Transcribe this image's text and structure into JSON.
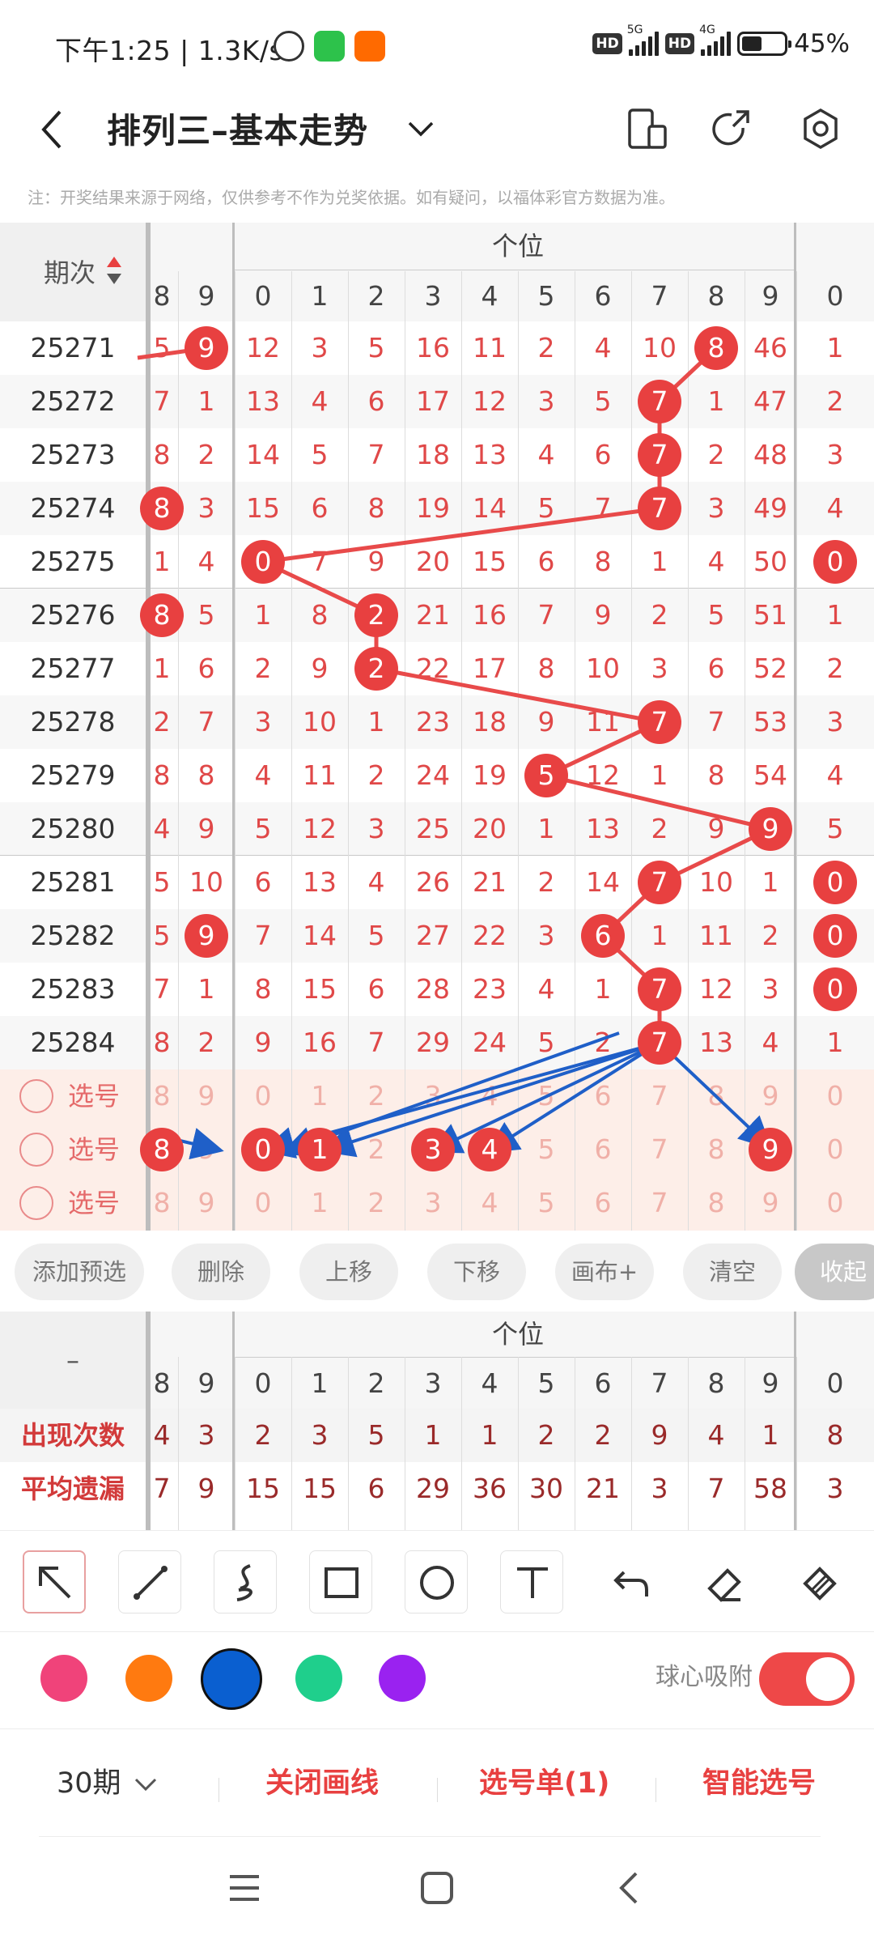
{
  "status_bar": {
    "time": "下午1:25",
    "speed": "1.3K/s",
    "battery": "45%",
    "net1": "5G",
    "net2": "4G",
    "hd": "HD"
  },
  "header": {
    "title": "排列三–基本走势"
  },
  "notice": "注：开奖结果来源于网络，仅供参考不作为兑奖依据。如有疑问，以福体彩官方数据为准。",
  "grid": {
    "period_header": "期次",
    "group_header": "个位",
    "columns": [
      "8",
      "9",
      "0",
      "1",
      "2",
      "3",
      "4",
      "5",
      "6",
      "7",
      "8",
      "9",
      "0"
    ],
    "rows": [
      {
        "p": "25271",
        "c": [
          "5",
          "9",
          "12",
          "3",
          "5",
          "16",
          "11",
          "2",
          "4",
          "10",
          "8",
          "46",
          "1"
        ]
      },
      {
        "p": "25272",
        "c": [
          "7",
          "1",
          "13",
          "4",
          "6",
          "17",
          "12",
          "3",
          "5",
          "7",
          "1",
          "47",
          "2"
        ]
      },
      {
        "p": "25273",
        "c": [
          "8",
          "2",
          "14",
          "5",
          "7",
          "18",
          "13",
          "4",
          "6",
          "7",
          "2",
          "48",
          "3"
        ]
      },
      {
        "p": "25274",
        "c": [
          "8",
          "3",
          "15",
          "6",
          "8",
          "19",
          "14",
          "5",
          "7",
          "7",
          "3",
          "49",
          "4"
        ]
      },
      {
        "p": "25275",
        "c": [
          "1",
          "4",
          "0",
          "7",
          "9",
          "20",
          "15",
          "6",
          "8",
          "1",
          "4",
          "50",
          "0"
        ]
      },
      {
        "p": "25276",
        "c": [
          "8",
          "5",
          "1",
          "8",
          "2",
          "21",
          "16",
          "7",
          "9",
          "2",
          "5",
          "51",
          "1"
        ]
      },
      {
        "p": "25277",
        "c": [
          "1",
          "6",
          "2",
          "9",
          "2",
          "22",
          "17",
          "8",
          "10",
          "3",
          "6",
          "52",
          "2"
        ]
      },
      {
        "p": "25278",
        "c": [
          "2",
          "7",
          "3",
          "10",
          "1",
          "23",
          "18",
          "9",
          "11",
          "7",
          "7",
          "53",
          "3"
        ]
      },
      {
        "p": "25279",
        "c": [
          "8",
          "8",
          "4",
          "11",
          "2",
          "24",
          "19",
          "5",
          "12",
          "1",
          "8",
          "54",
          "4"
        ]
      },
      {
        "p": "25280",
        "c": [
          "4",
          "9",
          "5",
          "12",
          "3",
          "25",
          "20",
          "1",
          "13",
          "2",
          "9",
          "9",
          "5"
        ]
      },
      {
        "p": "25281",
        "c": [
          "5",
          "10",
          "6",
          "13",
          "4",
          "26",
          "21",
          "2",
          "14",
          "7",
          "10",
          "1",
          "0"
        ]
      },
      {
        "p": "25282",
        "c": [
          "5",
          "9",
          "7",
          "14",
          "5",
          "27",
          "22",
          "3",
          "6",
          "1",
          "11",
          "2",
          "0"
        ]
      },
      {
        "p": "25283",
        "c": [
          "7",
          "1",
          "8",
          "15",
          "6",
          "28",
          "23",
          "4",
          "1",
          "7",
          "12",
          "3",
          "0"
        ]
      },
      {
        "p": "25284",
        "c": [
          "8",
          "2",
          "9",
          "16",
          "7",
          "29",
          "24",
          "5",
          "2",
          "7",
          "13",
          "4",
          "1"
        ]
      }
    ],
    "balls": [
      {
        "r": 0,
        "c": 1
      },
      {
        "r": 0,
        "c": 10
      },
      {
        "r": 1,
        "c": 9
      },
      {
        "r": 2,
        "c": 9
      },
      {
        "r": 3,
        "c": 0
      },
      {
        "r": 3,
        "c": 9
      },
      {
        "r": 4,
        "c": 2
      },
      {
        "r": 4,
        "c": 12
      },
      {
        "r": 5,
        "c": 0
      },
      {
        "r": 5,
        "c": 4
      },
      {
        "r": 6,
        "c": 4
      },
      {
        "r": 7,
        "c": 9
      },
      {
        "r": 8,
        "c": 7
      },
      {
        "r": 9,
        "c": 11
      },
      {
        "r": 10,
        "c": 9
      },
      {
        "r": 10,
        "c": 12
      },
      {
        "r": 11,
        "c": 1
      },
      {
        "r": 11,
        "c": 8
      },
      {
        "r": 11,
        "c": 12
      },
      {
        "r": 12,
        "c": 9
      },
      {
        "r": 12,
        "c": 12
      },
      {
        "r": 13,
        "c": 9
      }
    ],
    "option_label": "选号",
    "option_rows": [
      [
        "8",
        "9",
        "0",
        "1",
        "2",
        "3",
        "4",
        "5",
        "6",
        "7",
        "8",
        "9",
        "0"
      ],
      [
        "8",
        "9",
        "0",
        "1",
        "2",
        "3",
        "4",
        "5",
        "6",
        "7",
        "8",
        "9",
        "0"
      ],
      [
        "8",
        "9",
        "0",
        "1",
        "2",
        "3",
        "4",
        "5",
        "6",
        "7",
        "8",
        "9",
        "0"
      ]
    ],
    "selected_option_balls": [
      0,
      2,
      3,
      5,
      6,
      11
    ]
  },
  "actions": [
    "添加预选",
    "删除",
    "上移",
    "下移",
    "画布+",
    "清空",
    "收起"
  ],
  "stats": {
    "dash": "–",
    "group_header": "个位",
    "columns": [
      "8",
      "9",
      "0",
      "1",
      "2",
      "3",
      "4",
      "5",
      "6",
      "7",
      "8",
      "9",
      "0"
    ],
    "rows": [
      {
        "label": "出现次数",
        "c": [
          "4",
          "3",
          "2",
          "3",
          "5",
          "1",
          "1",
          "2",
          "2",
          "9",
          "4",
          "1",
          "8"
        ]
      },
      {
        "label": "平均遗漏",
        "c": [
          "7",
          "9",
          "15",
          "15",
          "6",
          "29",
          "36",
          "30",
          "21",
          "3",
          "7",
          "58",
          "3"
        ]
      }
    ]
  },
  "tools": [
    "select-arrow",
    "line",
    "curve",
    "rectangle",
    "circle",
    "text",
    "undo",
    "eraser",
    "clear-brush"
  ],
  "colors": [
    "#f0437a",
    "#ff7a10",
    "#0a5fd0",
    "#1fcf8c",
    "#9a22f0"
  ],
  "snap_label": "球心吸附",
  "snap_on": true,
  "bottom": {
    "periods": "30期",
    "close_lines": "关闭画线",
    "selection_list": "选号单(1)",
    "smart_pick": "智能选号"
  }
}
